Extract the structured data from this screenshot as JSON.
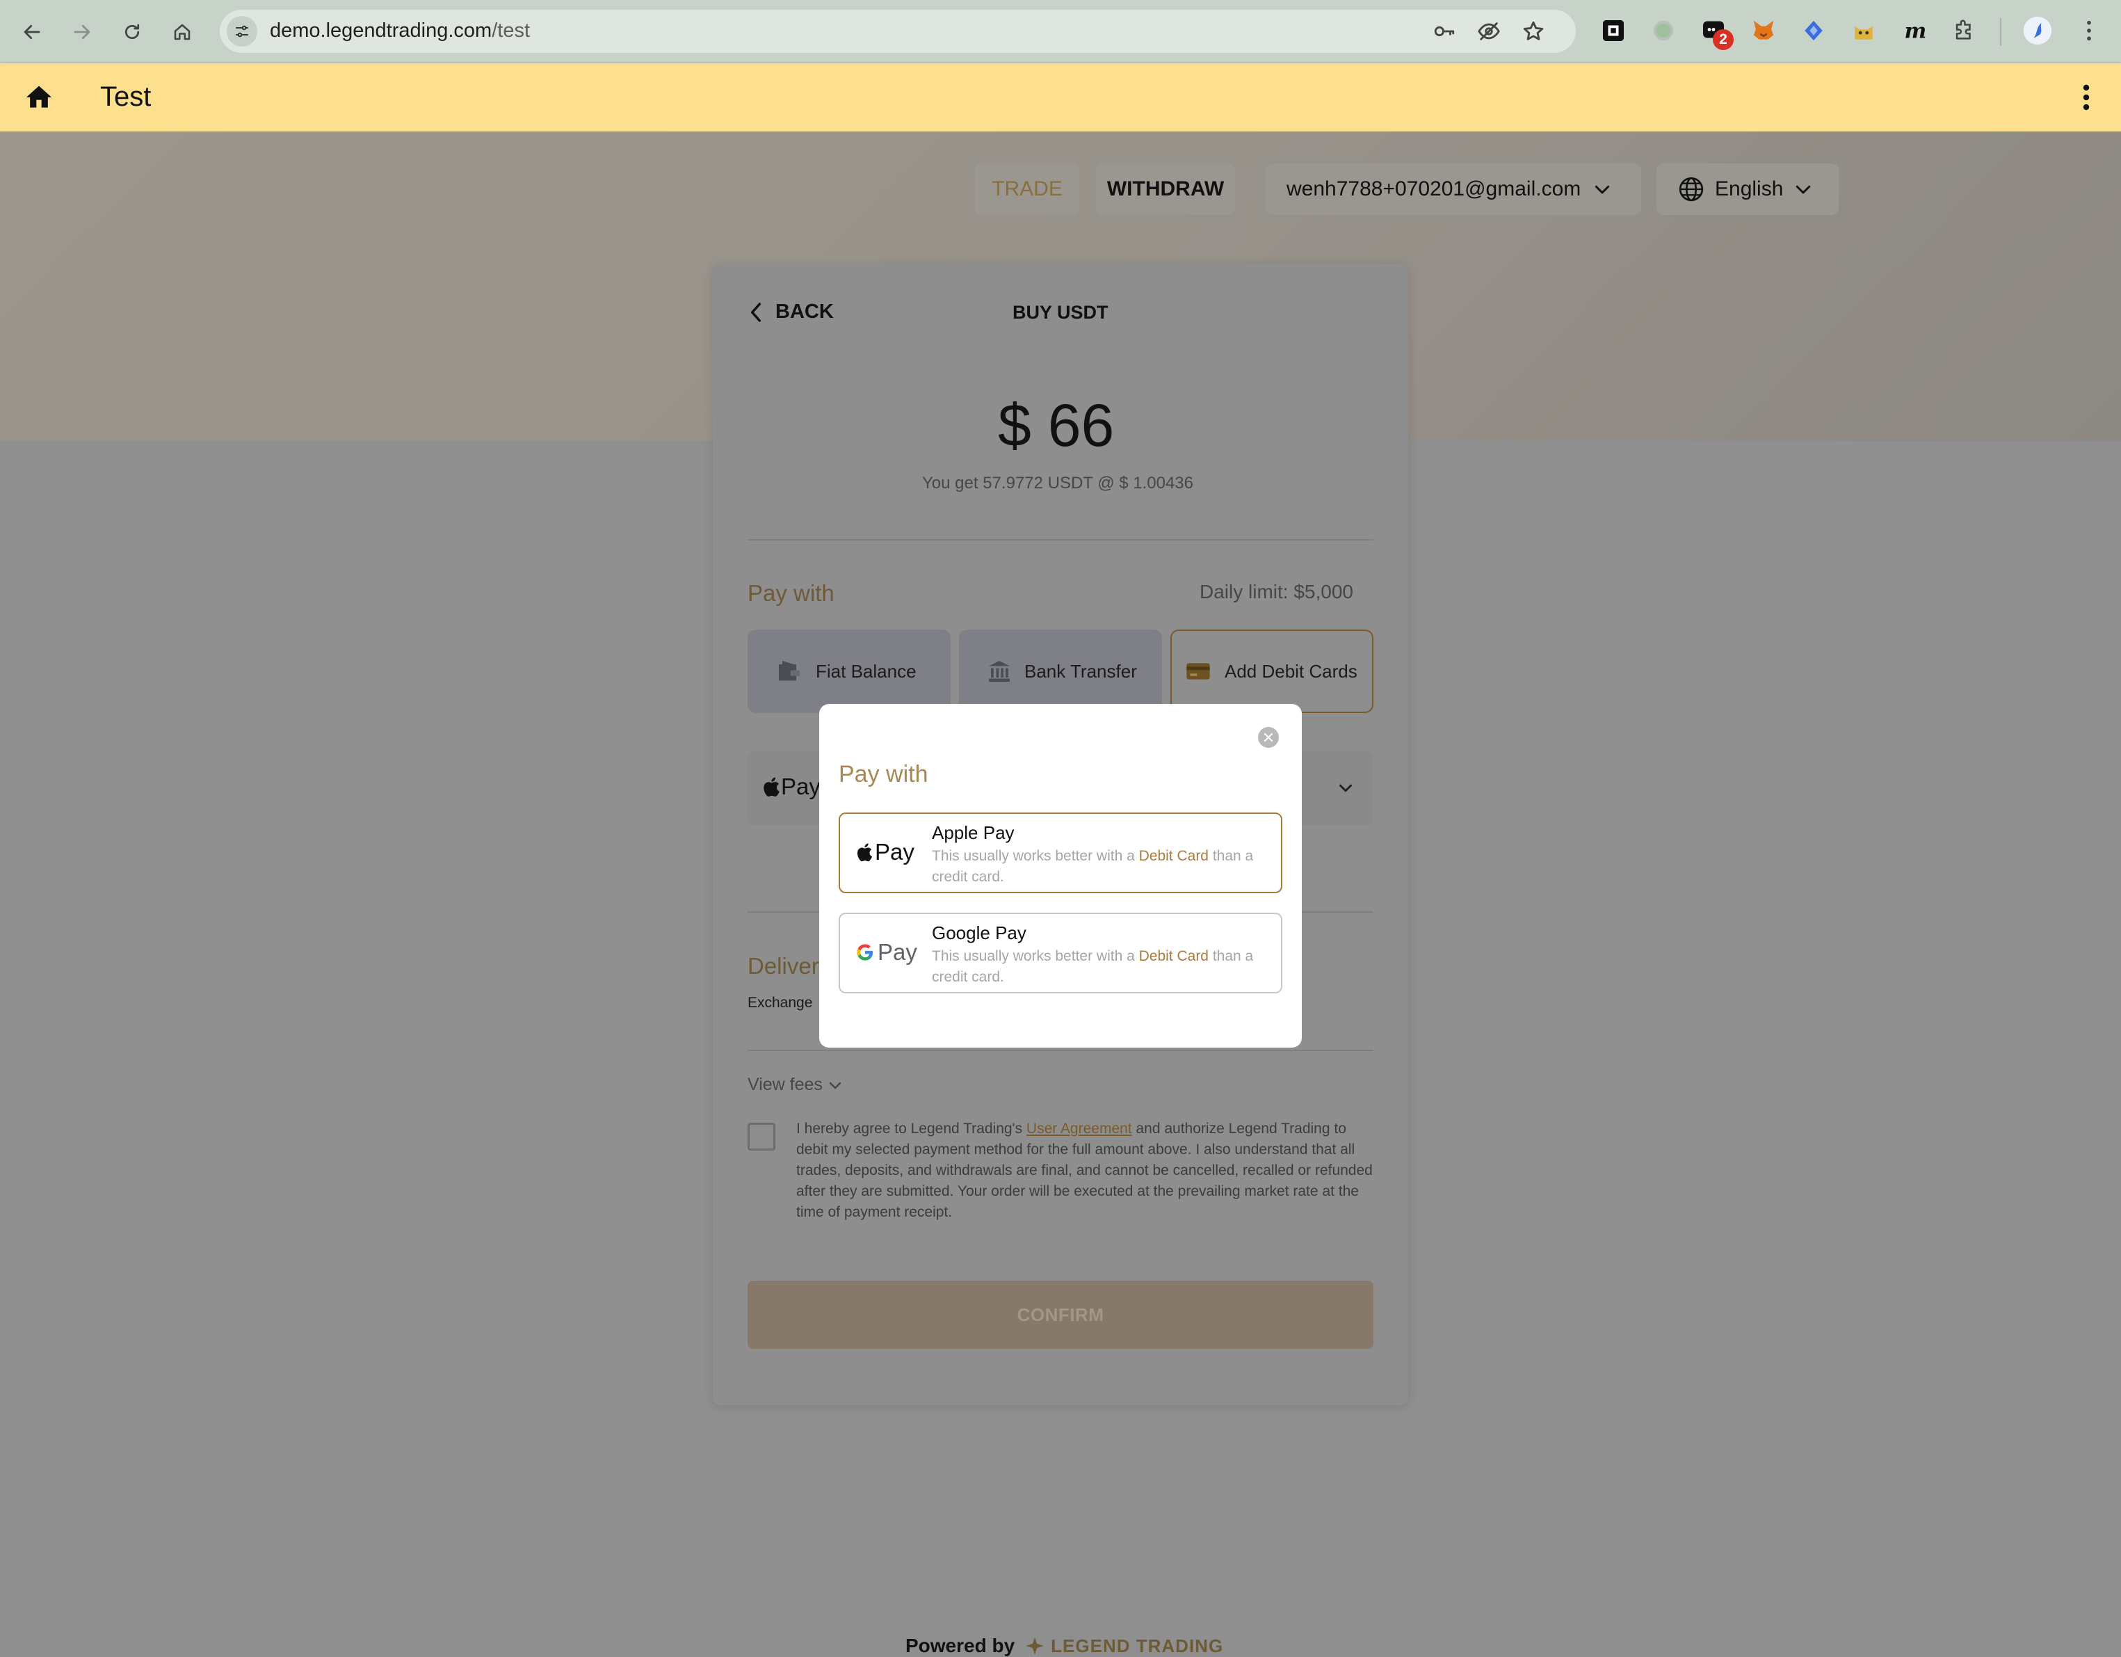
{
  "browser": {
    "url_host": "demo.legendtrading.com",
    "url_path": "/test",
    "extension_badge": "2"
  },
  "appbar": {
    "title": "Test"
  },
  "topnav": {
    "trade": "TRADE",
    "withdraw": "WITHDRAW",
    "account": "wenh7788+070201@gmail.com",
    "language": "English"
  },
  "card": {
    "back_label": "BACK",
    "title": "BUY USDT",
    "amount": "$ 66",
    "quote": "You get 57.9772 USDT @ $ 1.00436",
    "pay_with_label": "Pay with",
    "daily_limit": "Daily limit: $5,000",
    "pay_options": [
      "Fiat Balance",
      "Bank Transfer",
      "Add Debit Cards"
    ],
    "selected_wallet": "Pay",
    "delivery_label": "Deliver",
    "exchange_label": "Exchange",
    "view_fees": "View fees",
    "agreement_pre": "I hereby agree to Legend Trading's ",
    "agreement_link": "User Agreement",
    "agreement_post": " and authorize Legend Trading to debit my selected payment method for the full amount above. I also understand that all trades, deposits, and withdrawals are final, and cannot be cancelled, recalled or refunded after they are submitted. Your order will be executed at the prevailing market rate at the time of payment receipt.",
    "confirm_label": "CONFIRM"
  },
  "footer": {
    "powered_by": "Powered by",
    "brand": "LEGEND TRADING"
  },
  "modal": {
    "title": "Pay with",
    "options": [
      {
        "logo": "Pay",
        "name": "Apple Pay",
        "desc_pre": "This usually works better with a ",
        "desc_hl": "Debit Card",
        "desc_post": " than a credit card."
      },
      {
        "logo": "Pay",
        "name": "Google Pay",
        "desc_pre": "This usually works better with a ",
        "desc_hl": "Debit Card",
        "desc_post": " than a credit card."
      }
    ]
  },
  "colors": {
    "accent": "#a88854",
    "appbar": "#fde08d",
    "selected_border": "#a87c39"
  }
}
